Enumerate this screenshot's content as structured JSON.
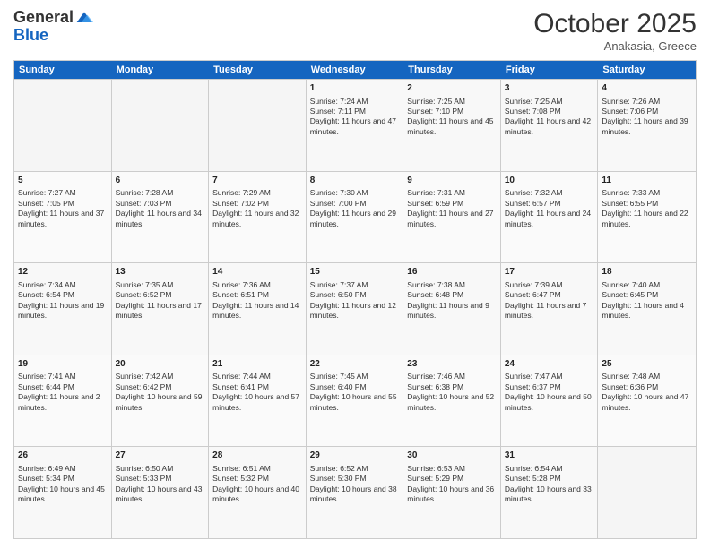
{
  "header": {
    "logo_general": "General",
    "logo_blue": "Blue",
    "month_title": "October 2025",
    "location": "Anakasia, Greece"
  },
  "weekdays": [
    "Sunday",
    "Monday",
    "Tuesday",
    "Wednesday",
    "Thursday",
    "Friday",
    "Saturday"
  ],
  "rows": [
    [
      {
        "day": "",
        "info": ""
      },
      {
        "day": "",
        "info": ""
      },
      {
        "day": "",
        "info": ""
      },
      {
        "day": "1",
        "info": "Sunrise: 7:24 AM\nSunset: 7:11 PM\nDaylight: 11 hours and 47 minutes."
      },
      {
        "day": "2",
        "info": "Sunrise: 7:25 AM\nSunset: 7:10 PM\nDaylight: 11 hours and 45 minutes."
      },
      {
        "day": "3",
        "info": "Sunrise: 7:25 AM\nSunset: 7:08 PM\nDaylight: 11 hours and 42 minutes."
      },
      {
        "day": "4",
        "info": "Sunrise: 7:26 AM\nSunset: 7:06 PM\nDaylight: 11 hours and 39 minutes."
      }
    ],
    [
      {
        "day": "5",
        "info": "Sunrise: 7:27 AM\nSunset: 7:05 PM\nDaylight: 11 hours and 37 minutes."
      },
      {
        "day": "6",
        "info": "Sunrise: 7:28 AM\nSunset: 7:03 PM\nDaylight: 11 hours and 34 minutes."
      },
      {
        "day": "7",
        "info": "Sunrise: 7:29 AM\nSunset: 7:02 PM\nDaylight: 11 hours and 32 minutes."
      },
      {
        "day": "8",
        "info": "Sunrise: 7:30 AM\nSunset: 7:00 PM\nDaylight: 11 hours and 29 minutes."
      },
      {
        "day": "9",
        "info": "Sunrise: 7:31 AM\nSunset: 6:59 PM\nDaylight: 11 hours and 27 minutes."
      },
      {
        "day": "10",
        "info": "Sunrise: 7:32 AM\nSunset: 6:57 PM\nDaylight: 11 hours and 24 minutes."
      },
      {
        "day": "11",
        "info": "Sunrise: 7:33 AM\nSunset: 6:55 PM\nDaylight: 11 hours and 22 minutes."
      }
    ],
    [
      {
        "day": "12",
        "info": "Sunrise: 7:34 AM\nSunset: 6:54 PM\nDaylight: 11 hours and 19 minutes."
      },
      {
        "day": "13",
        "info": "Sunrise: 7:35 AM\nSunset: 6:52 PM\nDaylight: 11 hours and 17 minutes."
      },
      {
        "day": "14",
        "info": "Sunrise: 7:36 AM\nSunset: 6:51 PM\nDaylight: 11 hours and 14 minutes."
      },
      {
        "day": "15",
        "info": "Sunrise: 7:37 AM\nSunset: 6:50 PM\nDaylight: 11 hours and 12 minutes."
      },
      {
        "day": "16",
        "info": "Sunrise: 7:38 AM\nSunset: 6:48 PM\nDaylight: 11 hours and 9 minutes."
      },
      {
        "day": "17",
        "info": "Sunrise: 7:39 AM\nSunset: 6:47 PM\nDaylight: 11 hours and 7 minutes."
      },
      {
        "day": "18",
        "info": "Sunrise: 7:40 AM\nSunset: 6:45 PM\nDaylight: 11 hours and 4 minutes."
      }
    ],
    [
      {
        "day": "19",
        "info": "Sunrise: 7:41 AM\nSunset: 6:44 PM\nDaylight: 11 hours and 2 minutes."
      },
      {
        "day": "20",
        "info": "Sunrise: 7:42 AM\nSunset: 6:42 PM\nDaylight: 10 hours and 59 minutes."
      },
      {
        "day": "21",
        "info": "Sunrise: 7:44 AM\nSunset: 6:41 PM\nDaylight: 10 hours and 57 minutes."
      },
      {
        "day": "22",
        "info": "Sunrise: 7:45 AM\nSunset: 6:40 PM\nDaylight: 10 hours and 55 minutes."
      },
      {
        "day": "23",
        "info": "Sunrise: 7:46 AM\nSunset: 6:38 PM\nDaylight: 10 hours and 52 minutes."
      },
      {
        "day": "24",
        "info": "Sunrise: 7:47 AM\nSunset: 6:37 PM\nDaylight: 10 hours and 50 minutes."
      },
      {
        "day": "25",
        "info": "Sunrise: 7:48 AM\nSunset: 6:36 PM\nDaylight: 10 hours and 47 minutes."
      }
    ],
    [
      {
        "day": "26",
        "info": "Sunrise: 6:49 AM\nSunset: 5:34 PM\nDaylight: 10 hours and 45 minutes."
      },
      {
        "day": "27",
        "info": "Sunrise: 6:50 AM\nSunset: 5:33 PM\nDaylight: 10 hours and 43 minutes."
      },
      {
        "day": "28",
        "info": "Sunrise: 6:51 AM\nSunset: 5:32 PM\nDaylight: 10 hours and 40 minutes."
      },
      {
        "day": "29",
        "info": "Sunrise: 6:52 AM\nSunset: 5:30 PM\nDaylight: 10 hours and 38 minutes."
      },
      {
        "day": "30",
        "info": "Sunrise: 6:53 AM\nSunset: 5:29 PM\nDaylight: 10 hours and 36 minutes."
      },
      {
        "day": "31",
        "info": "Sunrise: 6:54 AM\nSunset: 5:28 PM\nDaylight: 10 hours and 33 minutes."
      },
      {
        "day": "",
        "info": ""
      }
    ]
  ]
}
